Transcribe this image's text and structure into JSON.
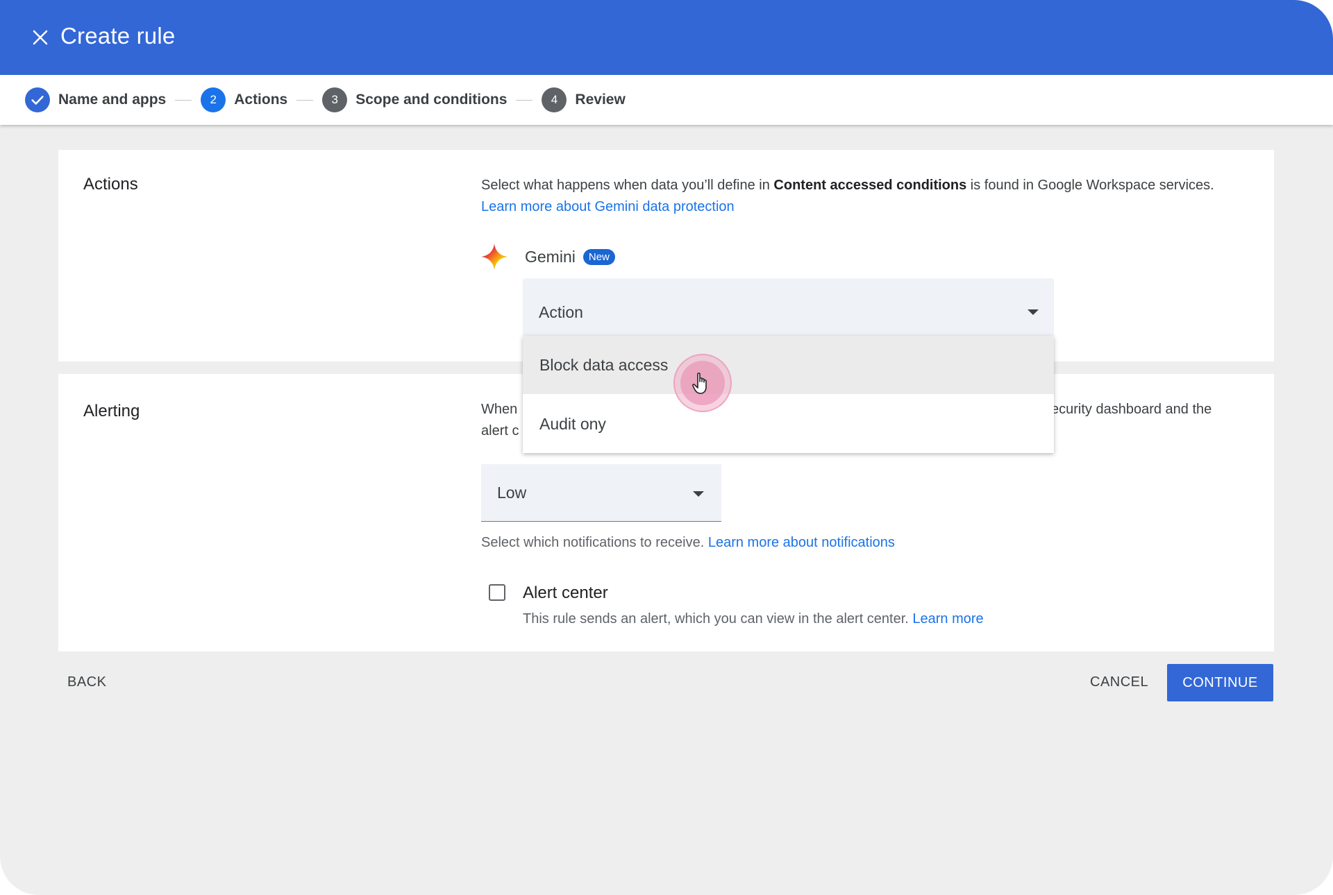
{
  "header": {
    "title": "Create rule"
  },
  "stepper": {
    "steps": [
      {
        "number": "",
        "label": "Name and apps",
        "status": "completed"
      },
      {
        "number": "2",
        "label": "Actions",
        "status": "active"
      },
      {
        "number": "3",
        "label": "Scope and conditions",
        "status": "upcoming"
      },
      {
        "number": "4",
        "label": "Review",
        "status": "upcoming"
      }
    ]
  },
  "actions_card": {
    "title": "Actions",
    "description_prefix": "Select what happens when data you’ll define in ",
    "description_bold": "Content accessed conditions",
    "description_suffix": " is found in Google Workspace services. ",
    "description_link": "Learn more about Gemini data protection",
    "gemini_label": "Gemini",
    "gemini_badge": "New",
    "action_select_value": "Action"
  },
  "action_dropdown": {
    "options": [
      "Block data access",
      "Audit ony"
    ],
    "hovered_index": 0
  },
  "alerting_card": {
    "title": "Alerting",
    "desc_line1_left": "When",
    "desc_line1_right": "ecurity dashboard and the",
    "desc_line2_left": "alert c",
    "severity_value": "Low",
    "notifications_text": "Select which notifications to receive. ",
    "notifications_link": "Learn more about notifications",
    "alert_center_label": "Alert center",
    "alert_center_checked": false,
    "alert_center_help": "This rule sends an alert, which you can view in the alert center. ",
    "alert_center_help_link": "Learn more"
  },
  "footer": {
    "back_label": "BACK",
    "cancel_label": "CANCEL",
    "continue_label": "CONTINUE"
  },
  "colors": {
    "header_bg": "#3367d6",
    "primary": "#1a73e8",
    "page_bg": "#eeeeee"
  }
}
